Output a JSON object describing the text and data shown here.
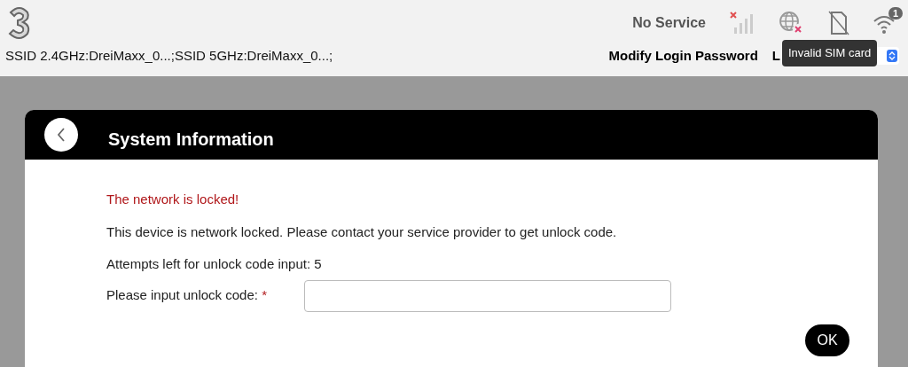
{
  "header": {
    "ssid": "SSID 2.4GHz:DreiMaxx_0...;SSID 5GHz:DreiMaxx_0...;",
    "status": "No Service",
    "wifi_count": "1",
    "links": [
      "Modify Login Password",
      "L"
    ],
    "tooltip": "Invalid SIM card"
  },
  "panel": {
    "title": "System Information",
    "alert": "The network is locked!",
    "message": "This device is network locked. Please contact your service provider to get unlock code.",
    "attempts": "Attempts left for unlock code input: 5",
    "field_label": "Please input unlock code:",
    "required_mark": "*",
    "button": "OK"
  }
}
